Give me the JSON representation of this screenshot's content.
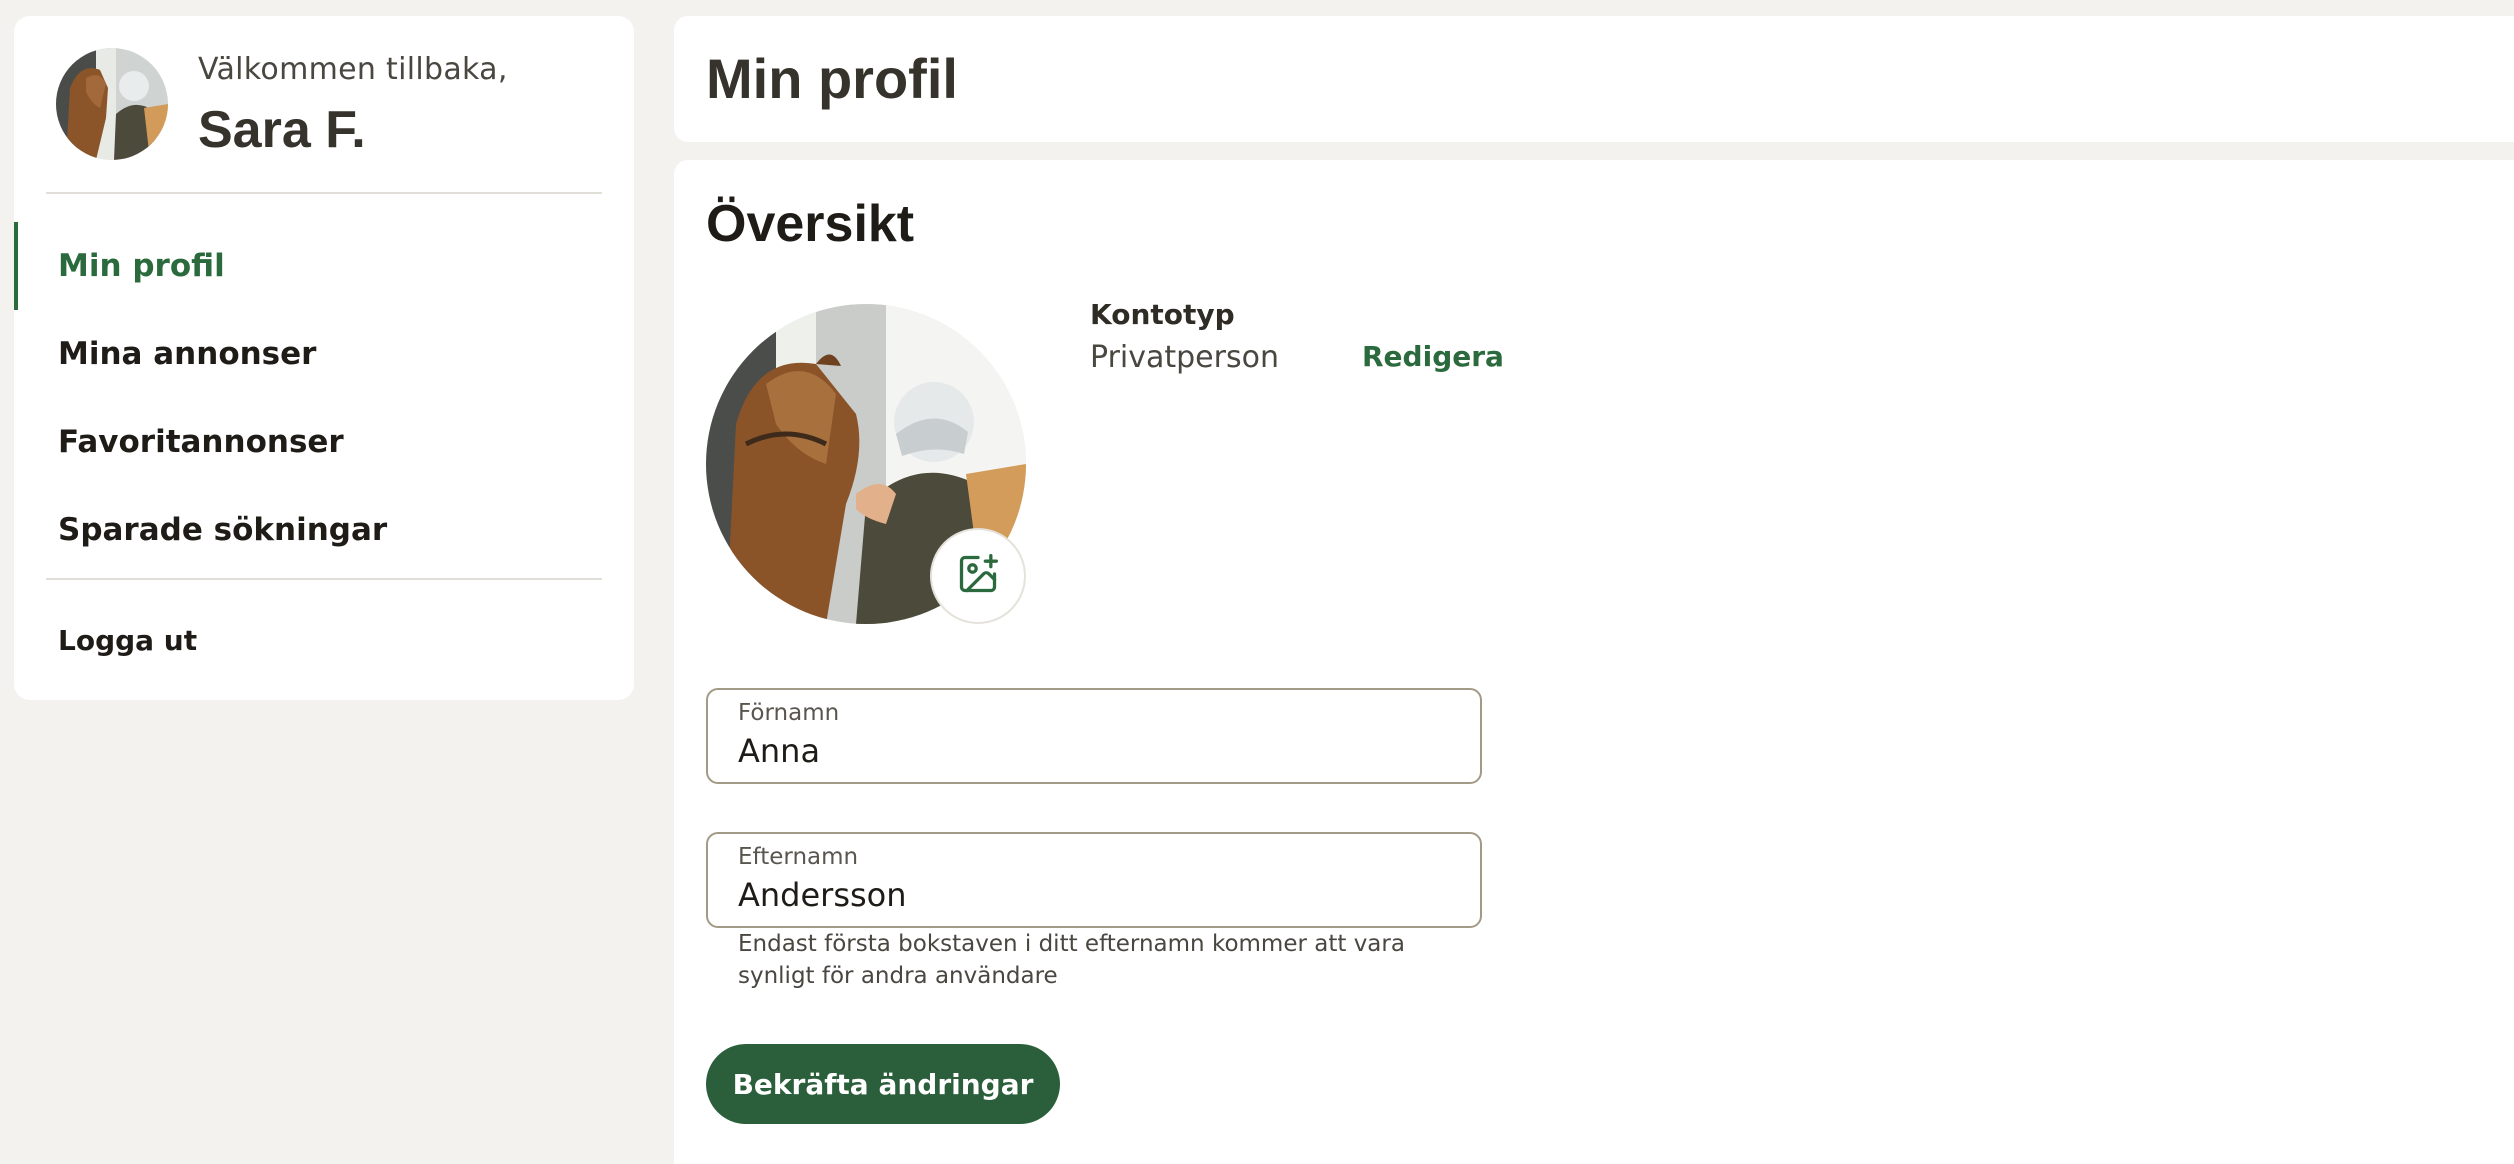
{
  "user": {
    "welcome": "Välkommen tillbaka,",
    "name": "Sara F."
  },
  "nav": {
    "items": [
      {
        "label": "Min profil",
        "active": true
      },
      {
        "label": "Mina annonser",
        "active": false
      },
      {
        "label": "Favoritannonser",
        "active": false
      },
      {
        "label": "Sparade sökningar",
        "active": false
      }
    ],
    "logout": "Logga ut"
  },
  "page": {
    "title": "Min profil"
  },
  "overview": {
    "title": "Översikt",
    "account_type_label": "Kontotyp",
    "account_type_value": "Privatperson",
    "edit_label": "Redigera"
  },
  "form": {
    "first_name": {
      "label": "Förnamn",
      "value": "Anna"
    },
    "last_name": {
      "label": "Efternamn",
      "value": "Andersson",
      "helper": "Endast första bokstaven i ditt efternamn kommer att vara synligt för andra användare"
    },
    "submit_label": "Bekräfta ändringar"
  },
  "icons": {
    "photo_button": "image-plus-icon"
  },
  "colors": {
    "accent": "#2b6a3d",
    "button": "#2b5e3b",
    "background": "#f3f2ef",
    "field_border": "#a39a86"
  }
}
